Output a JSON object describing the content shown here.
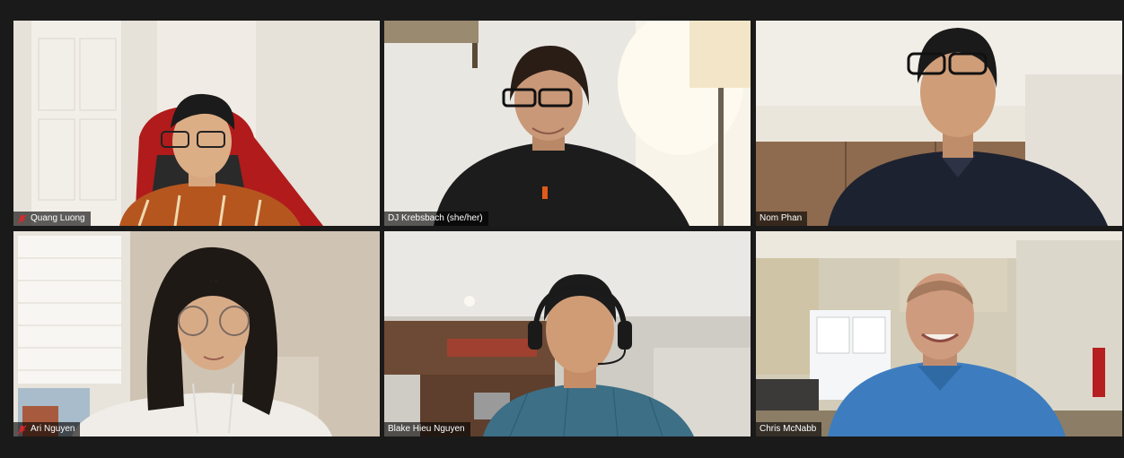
{
  "participants": [
    {
      "name": "Quang Luong",
      "muted": true,
      "active": false
    },
    {
      "name": "DJ Krebsbach (she/her)",
      "muted": false,
      "active": false
    },
    {
      "name": "Nom Phan",
      "muted": false,
      "active": false
    },
    {
      "name": "Ari Nguyen",
      "muted": true,
      "active": false
    },
    {
      "name": "Blake Hieu Nguyen",
      "muted": false,
      "active": false
    },
    {
      "name": "Chris McNabb",
      "muted": false,
      "active": true
    }
  ],
  "colors": {
    "background": "#1a1a1a",
    "active_speaker_border": "#c9e265",
    "muted_icon": "#e0262b"
  },
  "icons": {
    "muted": "mic-muted-icon"
  }
}
